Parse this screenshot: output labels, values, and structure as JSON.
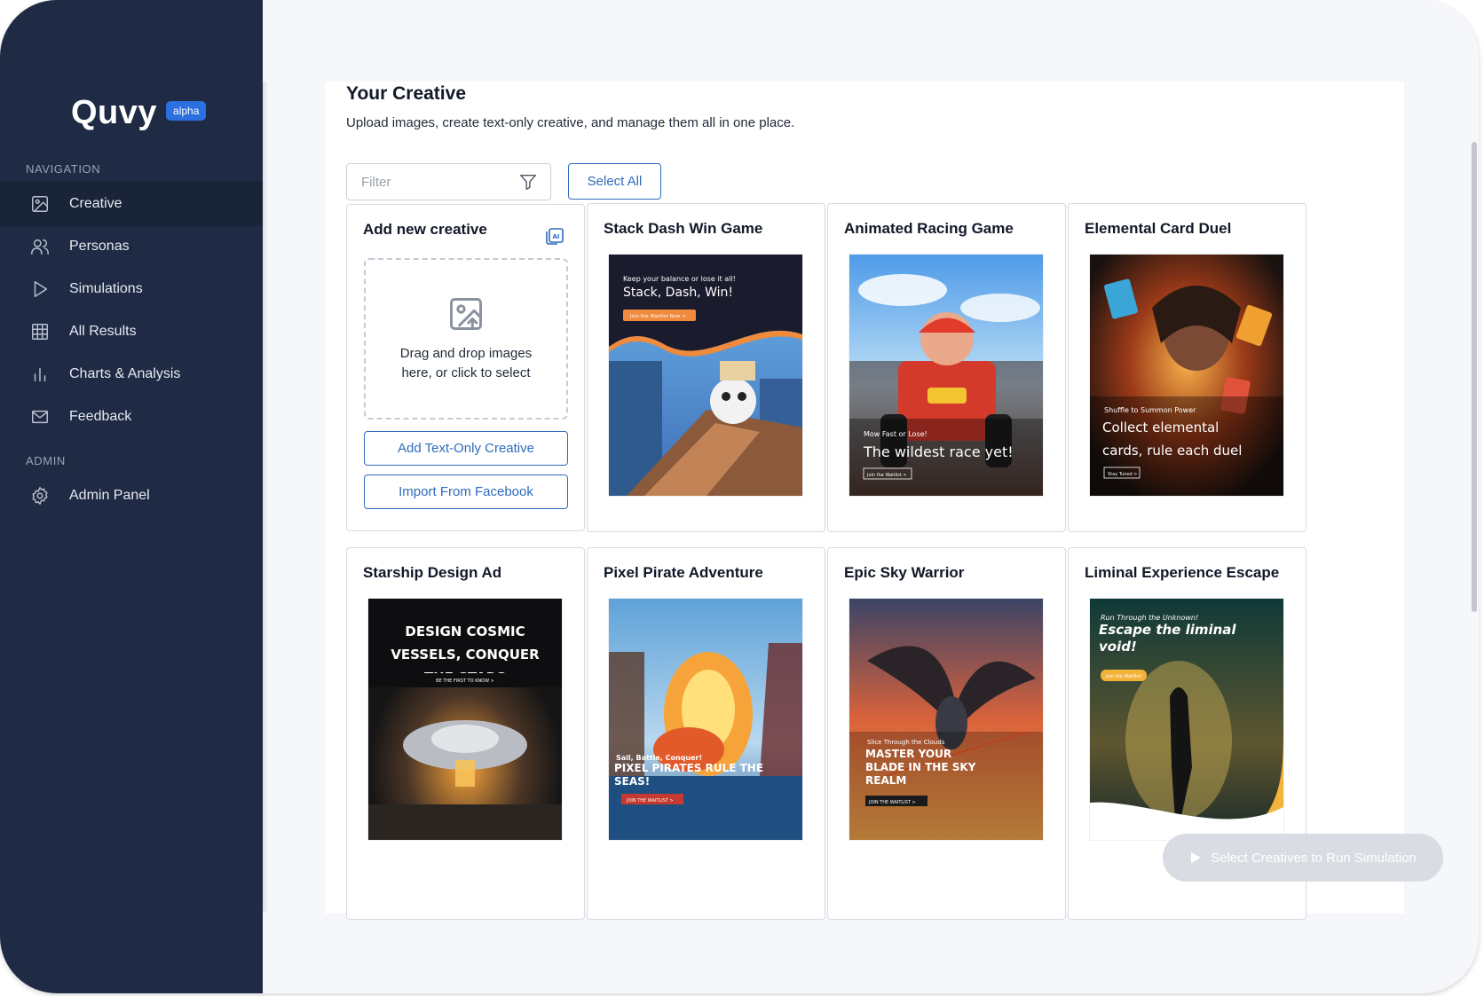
{
  "app": {
    "name": "Quvy",
    "badge": "alpha"
  },
  "sidebar": {
    "nav_heading": "NAVIGATION",
    "items": [
      {
        "label": "Creative",
        "icon": "image-icon",
        "active": true
      },
      {
        "label": "Personas",
        "icon": "users-icon"
      },
      {
        "label": "Simulations",
        "icon": "play-icon"
      },
      {
        "label": "All Results",
        "icon": "grid-icon"
      },
      {
        "label": "Charts & Analysis",
        "icon": "bar-chart-icon"
      },
      {
        "label": "Feedback",
        "icon": "mail-icon"
      }
    ],
    "admin_heading": "ADMIN",
    "admin_items": [
      {
        "label": "Admin Panel",
        "icon": "gear-icon"
      }
    ]
  },
  "page": {
    "title": "Your Creative",
    "subtitle": "Upload images, create text-only creative, and manage them all in one place.",
    "filter_placeholder": "Filter",
    "select_all": "Select All"
  },
  "add_card": {
    "title": "Add new creative",
    "dropzone_text": "Drag and drop images here, or click to select",
    "text_only_button": "Add Text-Only Creative",
    "facebook_button": "Import From Facebook"
  },
  "creatives": [
    {
      "title": "Stack Dash Win Game",
      "ad_small": "Keep your balance or lose it all!",
      "ad_headline": "Stack, Dash, Win!",
      "ad_cta": "Join the Waitlist Now >"
    },
    {
      "title": "Animated Racing Game",
      "ad_small": "Mow Fast or Lose!",
      "ad_headline": "The wildest race yet!",
      "ad_cta": "Join the Waitlist >"
    },
    {
      "title": "Elemental Card Duel",
      "ad_small": "Shuffle to Summon Power",
      "ad_headline": "Collect elemental cards, rule each duel",
      "ad_cta": "Stay Tuned >"
    },
    {
      "title": "Starship Design Ad",
      "ad_headline": "DESIGN COSMIC VESSELS, CONQUER THE STARS",
      "ad_cta": "BE THE FIRST TO KNOW >"
    },
    {
      "title": "Pixel Pirate Adventure",
      "ad_small": "Sail, Battle, Conquer!",
      "ad_headline": "PIXEL PIRATES RULE THE SEAS!",
      "ad_cta": "JOIN THE WAITLIST >"
    },
    {
      "title": "Epic Sky Warrior",
      "ad_small": "Slice Through the Clouds",
      "ad_headline": "MASTER YOUR BLADE IN THE SKY REALM",
      "ad_cta": "JOIN THE WAITLIST >"
    },
    {
      "title": "Liminal Experience Escape",
      "ad_small": "Run Through the Unknown!",
      "ad_headline": "Escape the liminal void!",
      "ad_cta": "Join the Waitlist!"
    }
  ],
  "run_simulation": "Select Creatives to Run Simulation",
  "colors": {
    "sidebar": "#1f2a44",
    "accent": "#2f6bbd",
    "badge": "#2b6fe0"
  }
}
